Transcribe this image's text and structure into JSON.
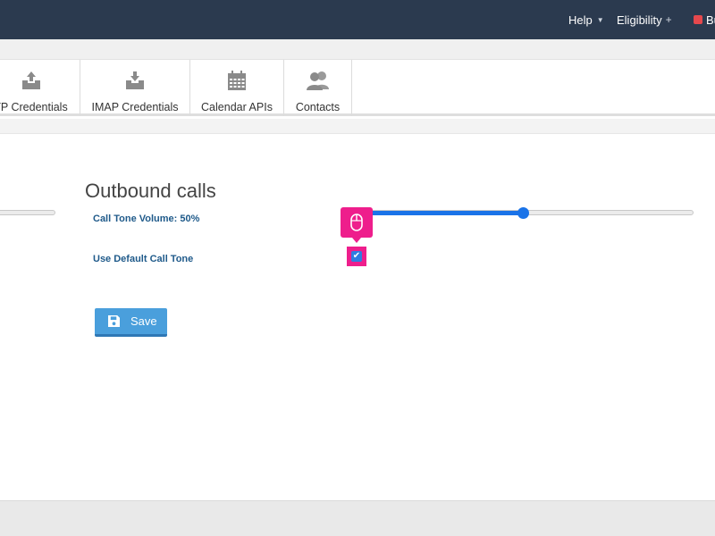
{
  "header": {
    "help_label": "Help",
    "eligibility_label": "Eligibility",
    "truncated_label": "Bu"
  },
  "tabs": [
    {
      "label": "TP Credentials",
      "icon": "inbox-upload-icon"
    },
    {
      "label": "IMAP Credentials",
      "icon": "inbox-download-icon"
    },
    {
      "label": "Calendar APIs",
      "icon": "calendar-icon"
    },
    {
      "label": "Contacts",
      "icon": "contacts-icon"
    }
  ],
  "form": {
    "section_title": "Outbound calls",
    "volume_label": "Call Tone Volume: 50%",
    "volume_value": 50,
    "default_tone_label": "Use Default Call Tone",
    "default_tone_checked": true,
    "save_label": "Save"
  },
  "colors": {
    "header_bg": "#2b3a4f",
    "accent": "#1a73e8",
    "save_button": "#4a9fdc",
    "cursor_highlight": "#ee1e8c",
    "label_color": "#1f5a8a"
  }
}
